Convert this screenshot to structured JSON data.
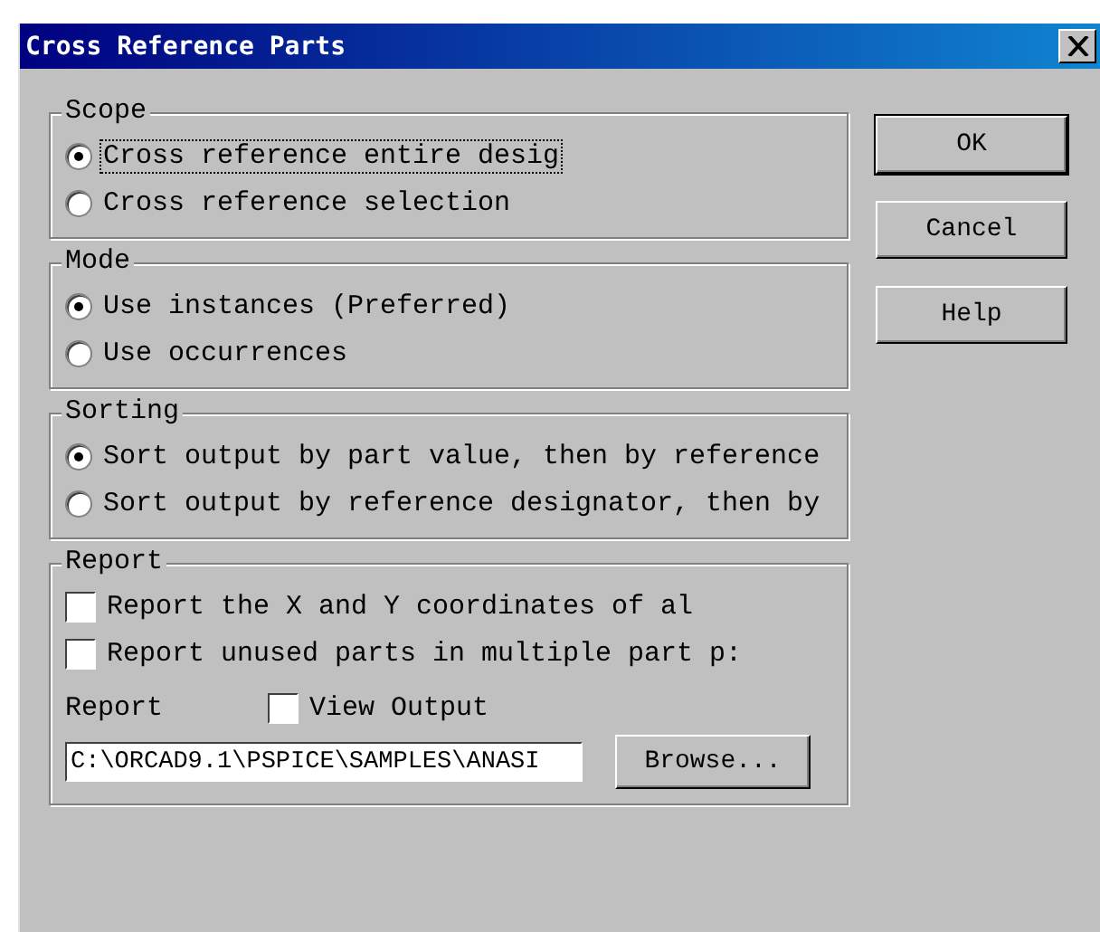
{
  "window": {
    "title": "Cross Reference Parts"
  },
  "groups": [
    {
      "title": "Scope",
      "kind": "radio",
      "items": [
        {
          "label": "Cross reference entire desig",
          "selected": true,
          "focused": true
        },
        {
          "label": "Cross reference selection",
          "selected": false,
          "focused": false
        }
      ]
    },
    {
      "title": "Mode",
      "kind": "radio",
      "items": [
        {
          "label": "Use instances (Preferred)",
          "selected": true
        },
        {
          "label": "Use occurrences",
          "selected": false
        }
      ]
    },
    {
      "title": "Sorting",
      "kind": "radio",
      "items": [
        {
          "label": "Sort output by part value, then by reference",
          "selected": true
        },
        {
          "label": "Sort output by reference designator, then by",
          "selected": false
        }
      ]
    },
    {
      "title": "Report",
      "kind": "checkbox",
      "items": [
        {
          "label": "Report the X and Y coordinates of al",
          "checked": false
        },
        {
          "label": "Report unused parts in multiple part p:",
          "checked": false
        }
      ],
      "file": {
        "label": "Report",
        "view_output": {
          "label": "View Output",
          "checked": false
        },
        "value": "C:\\ORCAD9.1\\PSPICE\\SAMPLES\\ANASI",
        "browse": "Browse..."
      }
    }
  ],
  "buttons": [
    {
      "label": "OK",
      "default": true
    },
    {
      "label": "Cancel",
      "default": false
    },
    {
      "label": "Help",
      "default": false
    }
  ]
}
